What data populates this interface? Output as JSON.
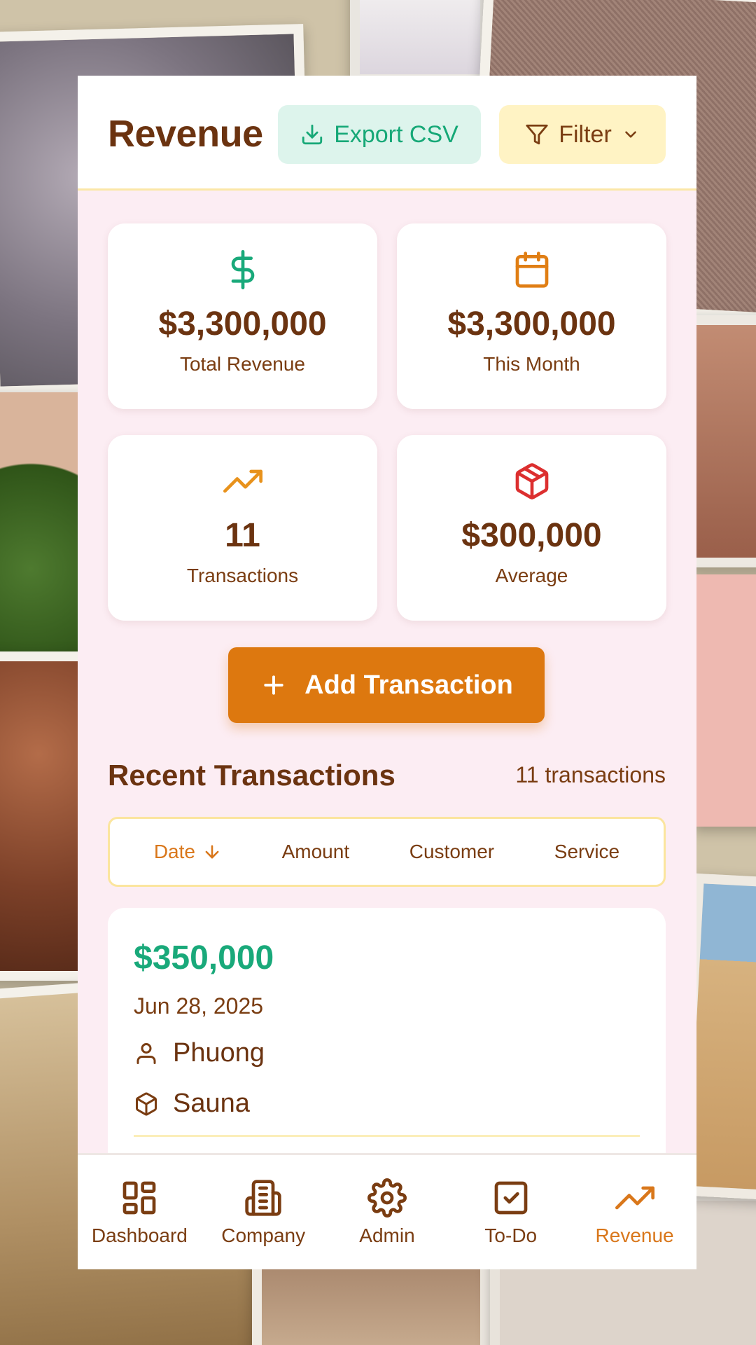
{
  "header": {
    "title": "Revenue",
    "export_label": "Export CSV",
    "filter_label": "Filter"
  },
  "stats": [
    {
      "icon": "dollar-icon",
      "value": "$3,300,000",
      "label": "Total Revenue",
      "color": "#19a97a"
    },
    {
      "icon": "calendar-icon",
      "value": "$3,300,000",
      "label": "This Month",
      "color": "#e07e14"
    },
    {
      "icon": "trending-up-icon",
      "value": "11",
      "label": "Transactions",
      "color": "#e8921c"
    },
    {
      "icon": "package-icon",
      "value": "$300,000",
      "label": "Average",
      "color": "#dc2f2f"
    }
  ],
  "add_button": {
    "label": "Add Transaction"
  },
  "recent": {
    "title": "Recent Transactions",
    "count_label": "11 transactions"
  },
  "sort": {
    "date": "Date",
    "amount": "Amount",
    "customer": "Customer",
    "service": "Service",
    "active": "date"
  },
  "transactions": [
    {
      "amount": "$350,000",
      "date": "Jun 28, 2025",
      "customer": "Phuong",
      "service": "Sauna"
    }
  ],
  "nav": [
    {
      "icon": "dashboard-icon",
      "label": "Dashboard"
    },
    {
      "icon": "building-icon",
      "label": "Company"
    },
    {
      "icon": "gear-icon",
      "label": "Admin"
    },
    {
      "icon": "checkbox-icon",
      "label": "To-Do"
    },
    {
      "icon": "trending-up-icon",
      "label": "Revenue",
      "active": true
    }
  ],
  "colors": {
    "brand_brown": "#6b3310",
    "accent_orange": "#dd780f",
    "accent_green": "#19a97a",
    "background_pink": "#fcedf3"
  }
}
